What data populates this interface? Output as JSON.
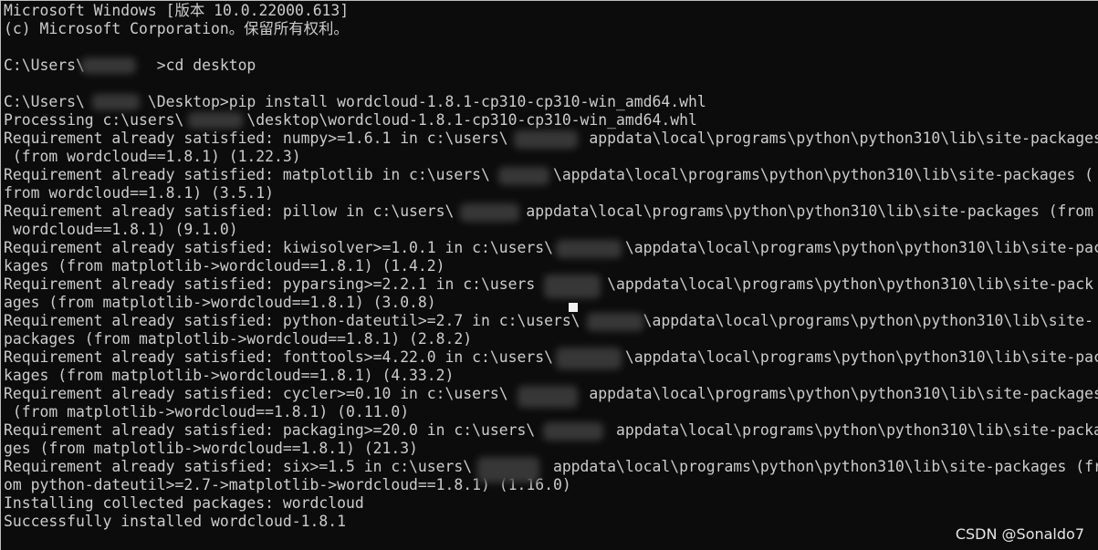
{
  "terminal": {
    "lines": [
      "Microsoft Windows [版本 10.0.22000.613]",
      "(c) Microsoft Corporation。保留所有权利。",
      "",
      "C:\\Users\\        >cd desktop",
      "",
      "C:\\Users\\       \\Desktop>pip install wordcloud-1.8.1-cp310-cp310-win_amd64.whl",
      "Processing c:\\users\\       \\desktop\\wordcloud-1.8.1-cp310-cp310-win_amd64.whl",
      "Requirement already satisfied: numpy>=1.6.1 in c:\\users\\         appdata\\local\\programs\\python\\python310\\lib\\site-packages",
      " (from wordcloud==1.8.1) (1.22.3)",
      "Requirement already satisfied: matplotlib in c:\\users\\       \\appdata\\local\\programs\\python\\python310\\lib\\site-packages (",
      "from wordcloud==1.8.1) (3.5.1)",
      "Requirement already satisfied: pillow in c:\\users\\        appdata\\local\\programs\\python\\python310\\lib\\site-packages (from",
      " wordcloud==1.8.1) (9.1.0)",
      "Requirement already satisfied: kiwisolver>=1.0.1 in c:\\users\\        \\appdata\\local\\programs\\python\\python310\\lib\\site-pac",
      "kages (from matplotlib->wordcloud==1.8.1) (1.4.2)",
      "Requirement already satisfied: pyparsing>=2.2.1 in c:\\users        \\appdata\\local\\programs\\python\\python310\\lib\\site-pack",
      "ages (from matplotlib->wordcloud==1.8.1) (3.0.8)",
      "Requirement already satisfied: python-dateutil>=2.7 in c:\\users\\       \\appdata\\local\\programs\\python\\python310\\lib\\site-",
      "packages (from matplotlib->wordcloud==1.8.1) (2.8.2)",
      "Requirement already satisfied: fonttools>=4.22.0 in c:\\users\\        \\appdata\\local\\programs\\python\\python310\\lib\\site-pac",
      "kages (from matplotlib->wordcloud==1.8.1) (4.33.2)",
      "Requirement already satisfied: cycler>=0.10 in c:\\users\\         appdata\\local\\programs\\python\\python310\\lib\\site-packages",
      " (from matplotlib->wordcloud==1.8.1) (0.11.0)",
      "Requirement already satisfied: packaging>=20.0 in c:\\users\\         appdata\\local\\programs\\python\\python310\\lib\\site-packa",
      "ges (from matplotlib->wordcloud==1.8.1) (21.3)",
      "Requirement already satisfied: six>=1.5 in c:\\users\\         appdata\\local\\programs\\python\\python310\\lib\\site-packages (fr",
      "om python-dateutil>=2.7->matplotlib->wordcloud==1.8.1) (1.16.0)",
      "Installing collected packages: wordcloud",
      "Successfully installed wordcloud-1.8.1"
    ]
  },
  "watermark": "CSDN @Sonaldo7",
  "colors": {
    "background": "#0c0c0c",
    "foreground": "#cccccc"
  }
}
